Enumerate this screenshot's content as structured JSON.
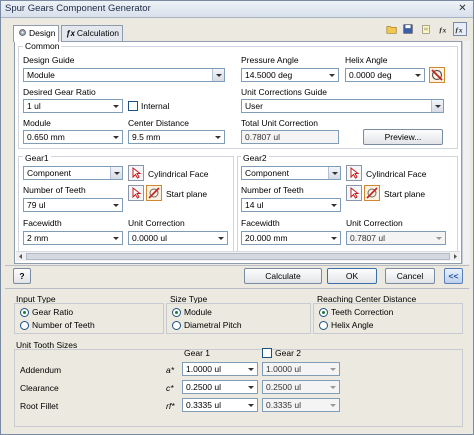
{
  "window": {
    "title": "Spur Gears Component Generator",
    "close": "✕"
  },
  "tabs": [
    {
      "label": "Design"
    },
    {
      "label": "Calculation"
    }
  ],
  "common": {
    "title": "Common",
    "design_guide_label": "Design Guide",
    "design_guide_value": "Module",
    "pressure_angle_label": "Pressure Angle",
    "pressure_angle_value": "14.5000 deg",
    "helix_angle_label": "Helix Angle",
    "helix_angle_value": "0.0000 deg",
    "desired_ratio_label": "Desired Gear Ratio",
    "desired_ratio_value": "1 ul",
    "internal_label": "Internal",
    "unit_corr_guide_label": "Unit Corrections Guide",
    "unit_corr_guide_value": "User",
    "module_label": "Module",
    "module_value": "0.650 mm",
    "center_distance_label": "Center Distance",
    "center_distance_value": "9.5 mm",
    "total_unit_corr_label": "Total Unit Correction",
    "total_unit_corr_value": "0.7807 ul",
    "preview_label": "Preview..."
  },
  "gear1": {
    "title": "Gear1",
    "type_value": "Component",
    "face_label": "Cylindrical Face",
    "start_label": "Start plane",
    "teeth_label": "Number of Teeth",
    "teeth_value": "79 ul",
    "facewidth_label": "Facewidth",
    "facewidth_value": "2 mm",
    "unit_corr_label": "Unit Correction",
    "unit_corr_value": "0.0000 ul"
  },
  "gear2": {
    "title": "Gear2",
    "type_value": "Component",
    "face_label": "Cylindrical Face",
    "start_label": "Start plane",
    "teeth_label": "Number of Teeth",
    "teeth_value": "14 ul",
    "facewidth_label": "Facewidth",
    "facewidth_value": "20.000 mm",
    "unit_corr_label": "Unit Correction",
    "unit_corr_value": "0.7807 ul"
  },
  "buttons": {
    "help": "?",
    "calculate": "Calculate",
    "ok": "OK",
    "cancel": "Cancel",
    "collapse": "<<"
  },
  "input_type": {
    "title": "Input Type",
    "options": [
      "Gear Ratio",
      "Number of Teeth"
    ],
    "selected": "Gear Ratio"
  },
  "size_type": {
    "title": "Size Type",
    "options": [
      "Module",
      "Diametral Pitch"
    ],
    "selected": "Module"
  },
  "reaching": {
    "title": "Reaching Center Distance",
    "options": [
      "Teeth Correction",
      "Helix Angle"
    ],
    "selected": "Teeth Correction"
  },
  "unit_tooth": {
    "title": "Unit Tooth Sizes",
    "gear1_header": "Gear 1",
    "gear2_header": "Gear 2",
    "rows": [
      {
        "label": "Addendum",
        "symbol": "a*",
        "g1": "1.0000 ul",
        "g2": "1.0000 ul"
      },
      {
        "label": "Clearance",
        "symbol": "c*",
        "g1": "0.2500 ul",
        "g2": "0.2500 ul"
      },
      {
        "label": "Root Fillet",
        "symbol": "rf*",
        "g1": "0.3335 ul",
        "g2": "0.3335 ul"
      }
    ]
  },
  "colors": {
    "accent": "#1c5180",
    "panel_bg": "#ffffff",
    "window_bg": "#ece9e0"
  }
}
